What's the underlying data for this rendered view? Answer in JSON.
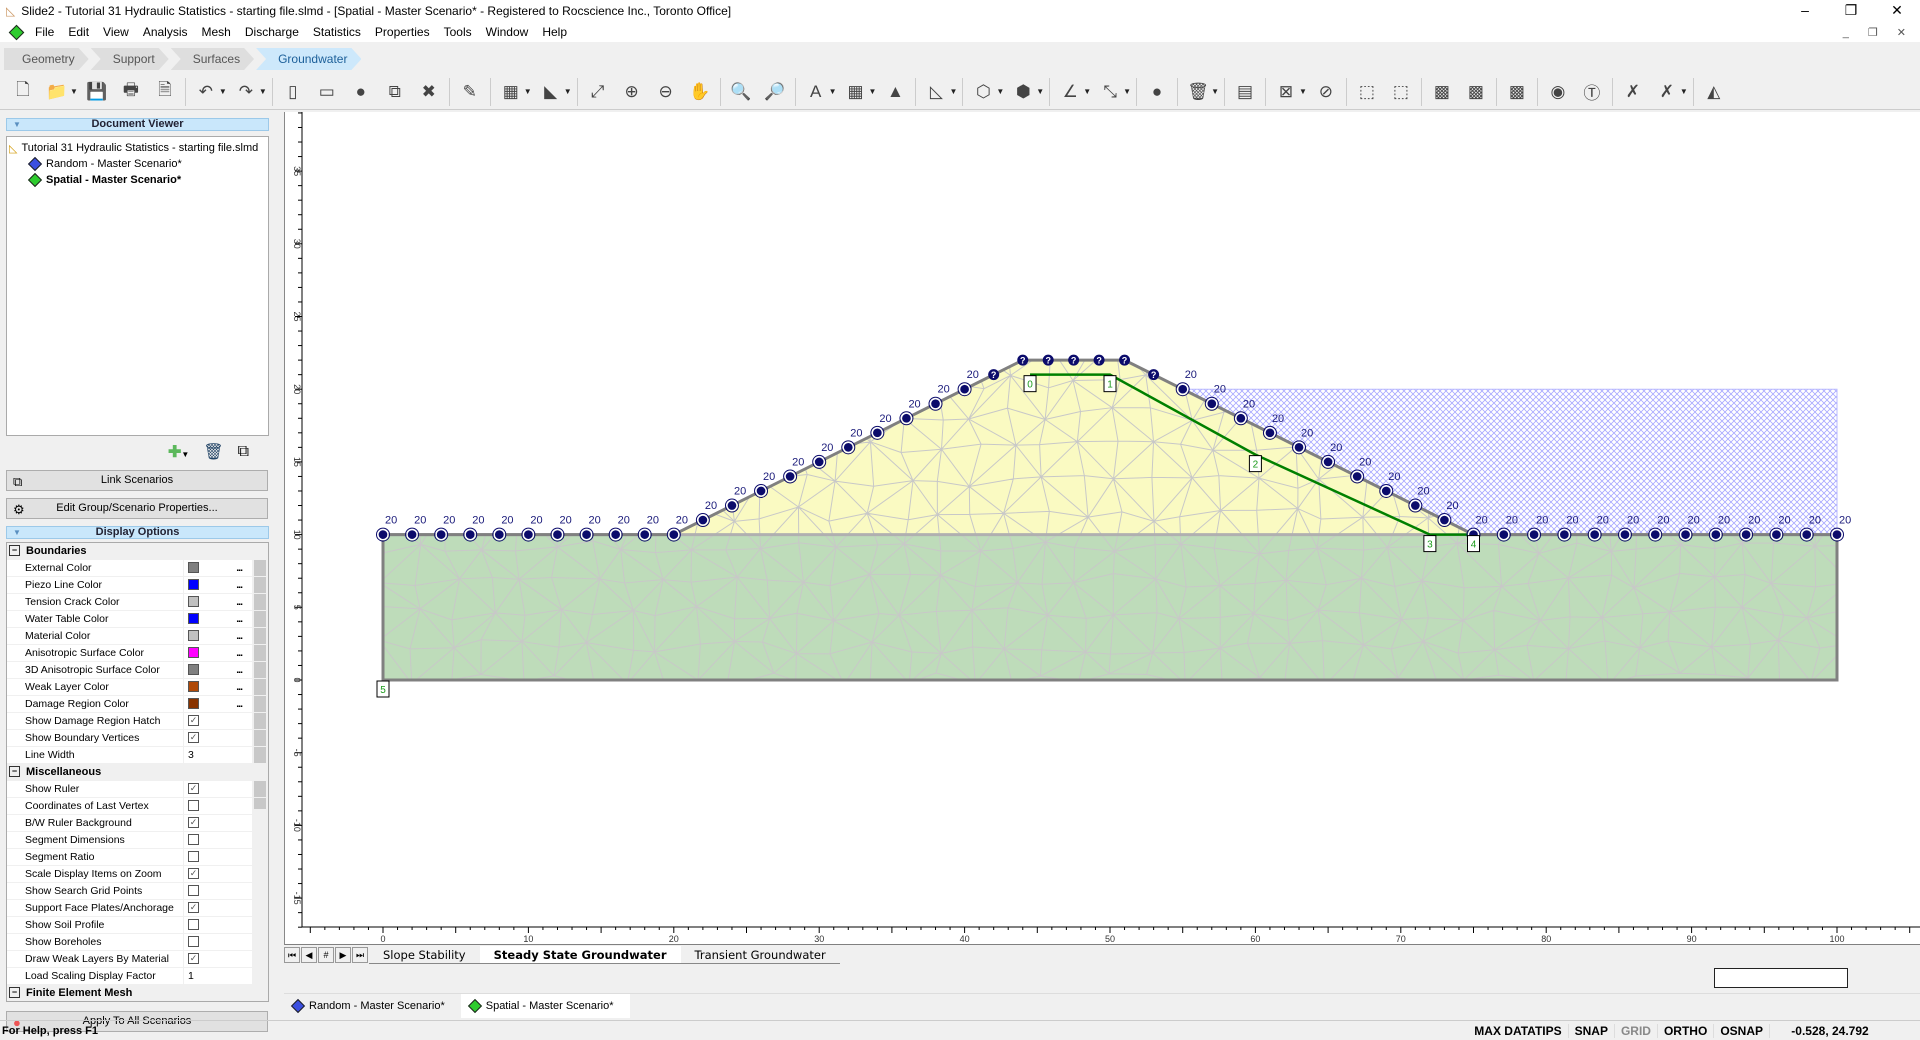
{
  "window": {
    "title": "Slide2 - Tutorial 31 Hydraulic Statistics - starting file.slmd - [Spatial - Master Scenario* - Registered to Rocscience Inc., Toronto Office]",
    "controls": [
      "–",
      "❐",
      "✕"
    ]
  },
  "menu": [
    "File",
    "Edit",
    "View",
    "Analysis",
    "Mesh",
    "Discharge",
    "Statistics",
    "Properties",
    "Tools",
    "Window",
    "Help"
  ],
  "workflow_tabs": [
    {
      "label": "Geometry",
      "active": false
    },
    {
      "label": "Support",
      "active": false
    },
    {
      "label": "Surfaces",
      "active": false
    },
    {
      "label": "Groundwater",
      "active": true
    }
  ],
  "toolbar": [
    {
      "icon": "new-file-icon",
      "glyph": "🗋"
    },
    {
      "icon": "open-folder-icon",
      "glyph": "📁",
      "dd": true
    },
    {
      "icon": "save-icon",
      "glyph": "💾"
    },
    {
      "icon": "print-icon",
      "glyph": "🖶"
    },
    {
      "icon": "export-image-icon",
      "glyph": "🗎"
    },
    {
      "sep": true
    },
    {
      "icon": "undo-icon",
      "glyph": "↶",
      "dd": true
    },
    {
      "icon": "redo-icon",
      "glyph": "↷",
      "dd": true
    },
    {
      "sep": true
    },
    {
      "icon": "tile-vertical-icon",
      "glyph": "▯"
    },
    {
      "icon": "tile-horizontal-icon",
      "glyph": "▭"
    },
    {
      "icon": "color-wheel-icon",
      "glyph": "●"
    },
    {
      "icon": "link-scenarios-icon",
      "glyph": "⧉"
    },
    {
      "icon": "close-scenario-icon",
      "glyph": "✖"
    },
    {
      "sep": true
    },
    {
      "icon": "edit-document-icon",
      "glyph": "✎"
    },
    {
      "sep": true
    },
    {
      "icon": "calculator-icon",
      "glyph": "▦",
      "dd": true
    },
    {
      "icon": "layer-icon",
      "glyph": "◣",
      "dd": true
    },
    {
      "sep": true
    },
    {
      "icon": "zoom-extents-icon",
      "glyph": "⤢"
    },
    {
      "icon": "zoom-in-icon",
      "glyph": "⊕"
    },
    {
      "icon": "zoom-out-icon",
      "glyph": "⊖"
    },
    {
      "icon": "pan-icon",
      "glyph": "✋"
    },
    {
      "sep": true
    },
    {
      "icon": "zoom-window-icon",
      "glyph": "🔍"
    },
    {
      "icon": "zoom-scale-icon",
      "glyph": "🔎"
    },
    {
      "sep": true
    },
    {
      "icon": "text-box-icon",
      "glyph": "A",
      "dd": true
    },
    {
      "icon": "table-icon",
      "glyph": "▦",
      "dd": true
    },
    {
      "icon": "picture-icon",
      "glyph": "▲"
    },
    {
      "sep": true
    },
    {
      "icon": "ruler-triangle-icon",
      "glyph": "◺",
      "dd": true
    },
    {
      "sep": true
    },
    {
      "icon": "polyline-icon",
      "glyph": "⬡",
      "dd": true
    },
    {
      "icon": "polygon-icon",
      "glyph": "⬢",
      "dd": true
    },
    {
      "sep": true
    },
    {
      "icon": "angle-icon",
      "glyph": "∠",
      "dd": true
    },
    {
      "icon": "dimension-icon",
      "glyph": "⤡",
      "dd": true
    },
    {
      "sep": true
    },
    {
      "icon": "sphere-icon",
      "glyph": "●"
    },
    {
      "sep": true
    },
    {
      "icon": "delete-icon",
      "glyph": "🗑",
      "dd": true
    },
    {
      "sep": true
    },
    {
      "icon": "materials-icon",
      "glyph": "▤"
    },
    {
      "sep": true
    },
    {
      "icon": "mesh-setup-icon",
      "glyph": "⊠",
      "dd": true
    },
    {
      "icon": "discretize-icon",
      "glyph": "⊘"
    },
    {
      "sep": true
    },
    {
      "icon": "mesh-boundary-icon",
      "glyph": "⬚"
    },
    {
      "icon": "mesh-edit-icon",
      "glyph": "⬚"
    },
    {
      "sep": true
    },
    {
      "icon": "mesh-grid-icon",
      "glyph": "▩"
    },
    {
      "icon": "mesh-refine-icon",
      "glyph": "▩"
    },
    {
      "sep": true
    },
    {
      "icon": "mesh-quality-icon",
      "glyph": "▩"
    },
    {
      "sep": true
    },
    {
      "icon": "flow-point-icon",
      "glyph": "◉"
    },
    {
      "icon": "flow-tangent-icon",
      "glyph": "Ⓣ"
    },
    {
      "sep": true
    },
    {
      "icon": "boundary-conditions-icon",
      "glyph": "✗"
    },
    {
      "icon": "remove-boundary-icon",
      "glyph": "✗",
      "dd": true
    },
    {
      "sep": true
    },
    {
      "icon": "piezo-edit-icon",
      "glyph": "◭"
    }
  ],
  "document_viewer": {
    "header": "Document Viewer",
    "file": "Tutorial 31 Hydraulic Statistics - starting file.slmd",
    "scenarios": [
      {
        "label": "Random - Master Scenario*",
        "color": "#3b4fe0",
        "bold": false
      },
      {
        "label": "Spatial - Master Scenario*",
        "color": "#2ecc2e",
        "bold": true
      }
    ]
  },
  "buttons": {
    "link_scenarios": "Link Scenarios",
    "edit_group": "Edit Group/Scenario Properties...",
    "apply_all": "Apply To All Scenarios"
  },
  "display_options": {
    "header": "Display Options",
    "sections": [
      {
        "title": "Boundaries",
        "rows": [
          {
            "label": "External Color",
            "color": "#808080"
          },
          {
            "label": "Piezo Line Color",
            "color": "#0000ff"
          },
          {
            "label": "Tension Crack Color",
            "color": "#c0c0c0"
          },
          {
            "label": "Water Table Color",
            "color": "#0000ff"
          },
          {
            "label": "Material Color",
            "color": "#c0c0c0"
          },
          {
            "label": "Anisotropic Surface Color",
            "color": "#ff00ff"
          },
          {
            "label": "3D Anisotropic Surface Color",
            "color": "#808080"
          },
          {
            "label": "Weak Layer Color",
            "color": "#b04a08"
          },
          {
            "label": "Damage Region Color",
            "color": "#883300"
          },
          {
            "label": "Show Damage Region Hatch",
            "checked": true
          },
          {
            "label": "Show Boundary Vertices",
            "checked": true
          },
          {
            "label": "Line Width",
            "value": "3"
          }
        ]
      },
      {
        "title": "Miscellaneous",
        "rows": [
          {
            "label": "Show Ruler",
            "checked": true
          },
          {
            "label": "Coordinates of Last Vertex",
            "checked": false
          },
          {
            "label": "B/W Ruler Background",
            "checked": true
          },
          {
            "label": "Segment Dimensions",
            "checked": false
          },
          {
            "label": "Segment Ratio",
            "checked": false
          },
          {
            "label": "Scale Display Items on Zoom",
            "checked": true
          },
          {
            "label": "Show Search Grid Points",
            "checked": false
          },
          {
            "label": "Support Face Plates/Anchorage",
            "checked": true
          },
          {
            "label": "Show Soil Profile",
            "checked": false
          },
          {
            "label": "Show Boreholes",
            "checked": false
          },
          {
            "label": "Draw Weak Layers By Material",
            "checked": true
          },
          {
            "label": "Load Scaling Display Factor",
            "value": "1"
          }
        ]
      },
      {
        "title": "Finite Element Mesh",
        "rows": []
      }
    ]
  },
  "model": {
    "x_ticks": [
      "0",
      "10",
      "20",
      "30",
      "40",
      "50",
      "60",
      "70",
      "80",
      "90",
      "100"
    ],
    "y_ticks": [
      "-15",
      "-10",
      "-5",
      "0",
      "5",
      "10",
      "15",
      "20",
      "25",
      "30",
      "35"
    ],
    "external_boundary": [
      [
        0,
        0
      ],
      [
        0,
        10
      ],
      [
        20,
        10
      ],
      [
        44,
        22
      ],
      [
        51,
        22
      ],
      [
        75,
        10
      ],
      [
        100,
        10
      ],
      [
        100,
        0
      ]
    ],
    "water_table": [
      [
        44.5,
        21
      ],
      [
        50,
        21
      ],
      [
        60,
        15.5
      ],
      [
        72,
        10
      ],
      [
        75,
        10
      ]
    ],
    "water_table_labels": [
      "0",
      "1",
      "2",
      "3",
      "4"
    ],
    "corner_label": "5",
    "ponded_level": 20,
    "boundary_head_label": "20",
    "unknown_bc_symbol": "?",
    "colors": {
      "upper_material": "#fafac2",
      "lower_material": "#bedcba",
      "boundary": "#808080",
      "water_table": "#008000",
      "mesh": "#c8c8c8",
      "bc_marker": "#0b0b6b",
      "pond_hatch": "#a8a8ff"
    }
  },
  "sheet_tabs": [
    {
      "label": "Slope Stability",
      "active": false
    },
    {
      "label": "Steady State Groundwater",
      "active": true
    },
    {
      "label": "Transient Groundwater",
      "active": false
    }
  ],
  "sheet_nav": [
    "⏮",
    "◀",
    "#",
    "▶",
    "⏭"
  ],
  "scenario_tabs": [
    {
      "label": "Random - Master Scenario*",
      "color": "#3b4fe0",
      "active": false
    },
    {
      "label": "Spatial - Master Scenario*",
      "color": "#2ecc2e",
      "active": true
    }
  ],
  "status": {
    "help": "For Help, press F1",
    "toggles": [
      {
        "label": "MAX DATATIPS",
        "on": true
      },
      {
        "label": "SNAP",
        "on": true
      },
      {
        "label": "GRID",
        "on": false
      },
      {
        "label": "ORTHO",
        "on": true
      },
      {
        "label": "OSNAP",
        "on": true
      }
    ],
    "coords": "-0.528,  24.792"
  }
}
